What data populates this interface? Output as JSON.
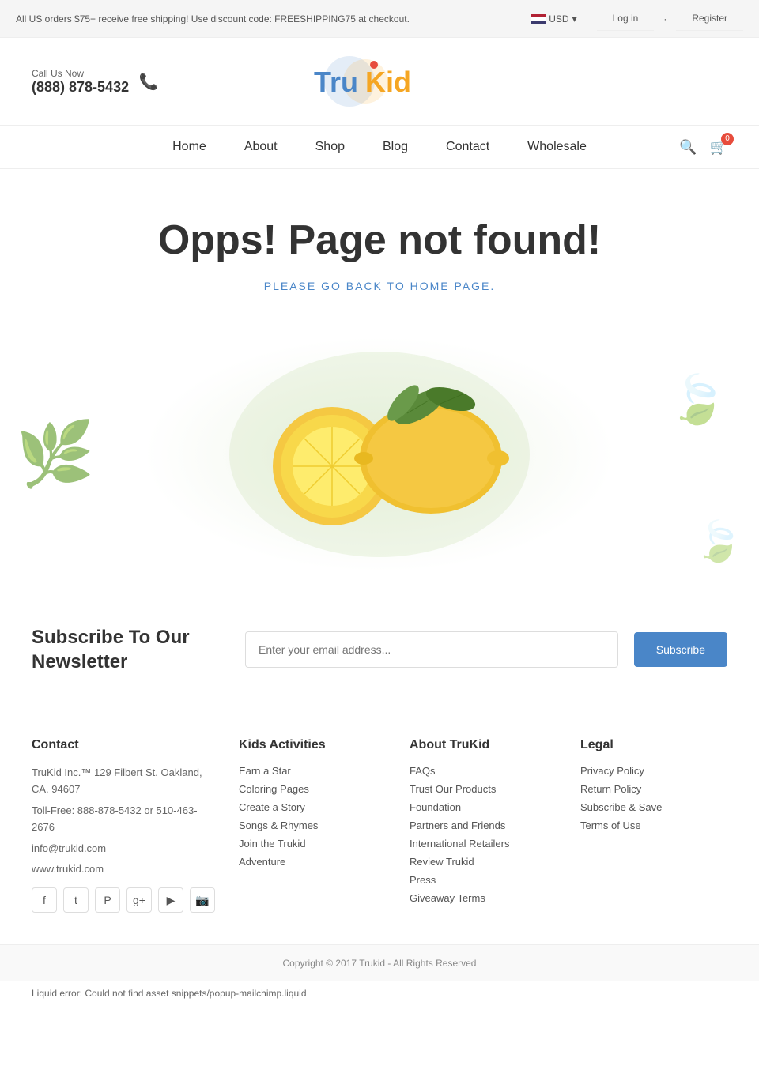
{
  "topBanner": {
    "message": "All US orders $75+ receive free shipping! Use discount code: FREESHIPPING75 at checkout.",
    "currency": "USD",
    "loginLabel": "Log in",
    "registerLabel": "Register"
  },
  "header": {
    "callLabel": "Call Us Now",
    "phone": "(888) 878-5432",
    "logoTru": "Tru",
    "logoKid": "Kid"
  },
  "nav": {
    "items": [
      {
        "label": "Home",
        "href": "#"
      },
      {
        "label": "About",
        "href": "#"
      },
      {
        "label": "Shop",
        "href": "#"
      },
      {
        "label": "Blog",
        "href": "#"
      },
      {
        "label": "Contact",
        "href": "#"
      },
      {
        "label": "Wholesale",
        "href": "#"
      }
    ],
    "cartCount": "0"
  },
  "error": {
    "title": "Opps! Page not found!",
    "subtitle": "PLEASE GO BACK TO HOME PAGE."
  },
  "newsletter": {
    "title": "Subscribe To Our Newsletter",
    "inputPlaceholder": "Enter your email address...",
    "buttonLabel": "Subscribe"
  },
  "footer": {
    "contact": {
      "title": "Contact",
      "address": "TruKid Inc.™ 129 Filbert St. Oakland, CA. 94607",
      "tollfree": "Toll-Free: 888-878-5432 or 510-463-2676",
      "email": "info@trukid.com",
      "website": "www.trukid.com"
    },
    "kidsActivities": {
      "title": "Kids Activities",
      "links": [
        "Earn a Star",
        "Coloring Pages",
        "Create a Story",
        "Songs & Rhymes",
        "Join the Trukid",
        "Adventure"
      ]
    },
    "aboutTrukid": {
      "title": "About TruKid",
      "links": [
        "FAQs",
        "Trust Our Products",
        "Foundation",
        "Partners and Friends",
        "International Retailers",
        "Review Trukid",
        "Press",
        "Giveaway Terms"
      ]
    },
    "legal": {
      "title": "Legal",
      "links": [
        "Privacy Policy",
        "Return Policy",
        "Subscribe & Save",
        "Terms of Use"
      ]
    }
  },
  "copyright": {
    "text": "Copyright © 2017 Trukid - All Rights Reserved"
  },
  "liquidError": {
    "text": "Liquid error: Could not find asset snippets/popup-mailchimp.liquid"
  }
}
